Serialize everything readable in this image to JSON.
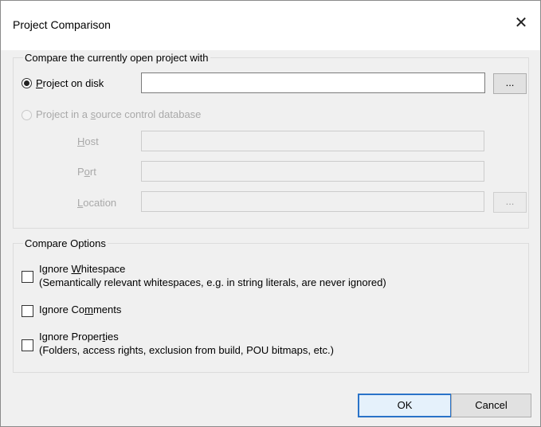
{
  "window": {
    "title": "Project Comparison",
    "close_glyph": "✕"
  },
  "compare_group": {
    "legend": "Compare the currently open project with",
    "disk": {
      "label_pre": "",
      "label_u": "P",
      "label_post": "roject on disk",
      "value": "",
      "browse": "..."
    },
    "source_control": {
      "label_pre": "Project in a ",
      "label_u": "s",
      "label_post": "ource control database",
      "host": {
        "u": "H",
        "rest": "ost",
        "value": ""
      },
      "port": {
        "pre": "P",
        "u": "o",
        "rest": "rt",
        "value": ""
      },
      "location": {
        "u": "L",
        "rest": "ocation",
        "value": ""
      },
      "browse": "..."
    }
  },
  "options_group": {
    "legend": "Compare Options",
    "whitespace": {
      "pre": "Ignore ",
      "u": "W",
      "post": "hitespace",
      "desc": "(Semantically relevant whitespaces, e.g. in string literals, are never ignored)",
      "checked": false
    },
    "comments": {
      "pre": "Ignore Co",
      "u": "m",
      "post": "ments",
      "checked": false
    },
    "properties": {
      "pre": "Ignore Proper",
      "u": "t",
      "post": "ies",
      "desc": "(Folders, access rights, exclusion from build, POU bitmaps, etc.)",
      "checked": false
    }
  },
  "buttons": {
    "ok": "OK",
    "cancel": "Cancel"
  }
}
